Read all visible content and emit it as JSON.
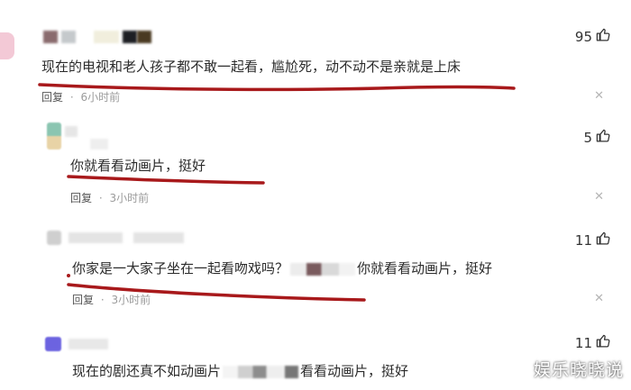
{
  "comments": [
    {
      "text": "现在的电视和老人孩子都不敢一起看，尴尬死，动不动不是亲就是上床",
      "reply_label": "回复",
      "sep": "·",
      "time": "6小时前",
      "likes": "95",
      "close": "✕"
    },
    {
      "text": "你就看看动画片，挺好",
      "reply_label": "回复",
      "sep": "·",
      "time": "3小时前",
      "likes": "5",
      "close": "✕"
    },
    {
      "text_a": "你家是一大家子坐在一起看吻戏吗？",
      "text_b": "你就看看动画片，挺好",
      "reply_label": "回复",
      "sep": "·",
      "time": "3小时前",
      "likes": "11",
      "close": "✕"
    },
    {
      "text_a": "现在的剧还真不如动画片",
      "text_b": "看看动画片，挺好",
      "likes": "11"
    }
  ],
  "watermark": "娱乐晓晓说",
  "colors": {
    "underline": "#a8191b",
    "meta": "#9b9b9b"
  },
  "icons": {
    "like": "thumbs-up-icon",
    "close": "close-icon"
  }
}
